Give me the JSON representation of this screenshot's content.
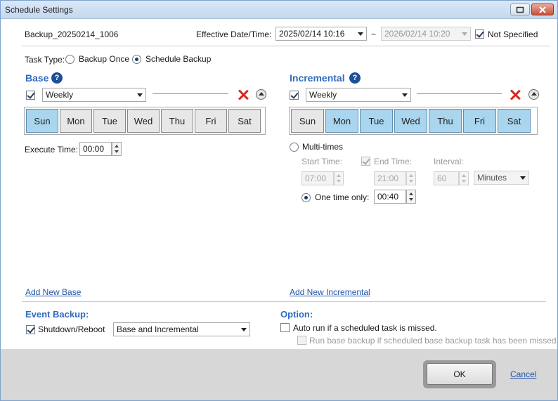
{
  "window": {
    "title": "Schedule Settings"
  },
  "header": {
    "task_name": "Backup_20250214_1006",
    "effective_label": "Effective Date/Time:",
    "start_value": "2025/02/14 10:16",
    "tilde": "~",
    "end_value": "2026/02/14 10:20",
    "not_specified_label": "Not Specified"
  },
  "task_type": {
    "label": "Task Type:",
    "option_once": "Backup Once",
    "option_schedule": "Schedule Backup",
    "selected": "Schedule Backup"
  },
  "base": {
    "title": "Base",
    "help": "?",
    "frequency": "Weekly",
    "days": [
      {
        "label": "Sun",
        "on": true
      },
      {
        "label": "Mon",
        "on": false
      },
      {
        "label": "Tue",
        "on": false
      },
      {
        "label": "Wed",
        "on": false
      },
      {
        "label": "Thu",
        "on": false
      },
      {
        "label": "Fri",
        "on": false
      },
      {
        "label": "Sat",
        "on": false
      }
    ],
    "execute_time_label": "Execute Time:",
    "execute_time": "00:00",
    "add_link": "Add New Base"
  },
  "incremental": {
    "title": "Incremental",
    "help": "?",
    "frequency": "Weekly",
    "days": [
      {
        "label": "Sun",
        "on": false
      },
      {
        "label": "Mon",
        "on": true
      },
      {
        "label": "Tue",
        "on": true
      },
      {
        "label": "Wed",
        "on": true
      },
      {
        "label": "Thu",
        "on": true
      },
      {
        "label": "Fri",
        "on": true
      },
      {
        "label": "Sat",
        "on": true
      }
    ],
    "multi_times_label": "Multi-times",
    "start_time_label": "Start Time:",
    "start_time": "07:00",
    "end_time_label": "End Time:",
    "end_time": "21:00",
    "interval_label": "Interval:",
    "interval_value": "60",
    "interval_unit": "Minutes",
    "one_time_label": "One time only:",
    "one_time_value": "00:40",
    "add_link": "Add New Incremental"
  },
  "event_backup": {
    "title": "Event Backup:",
    "shutdown_label": "Shutdown/Reboot",
    "mode": "Base and Incremental"
  },
  "option": {
    "title": "Option:",
    "auto_run_label": "Auto run if a scheduled task is missed.",
    "run_base_label": "Run base backup if scheduled base backup task has been missed."
  },
  "buttons": {
    "ok": "OK",
    "cancel": "Cancel"
  },
  "colors": {
    "accent": "#2f6bbf",
    "day_selected": "#a9d6ee",
    "delete": "#d32a1e"
  }
}
